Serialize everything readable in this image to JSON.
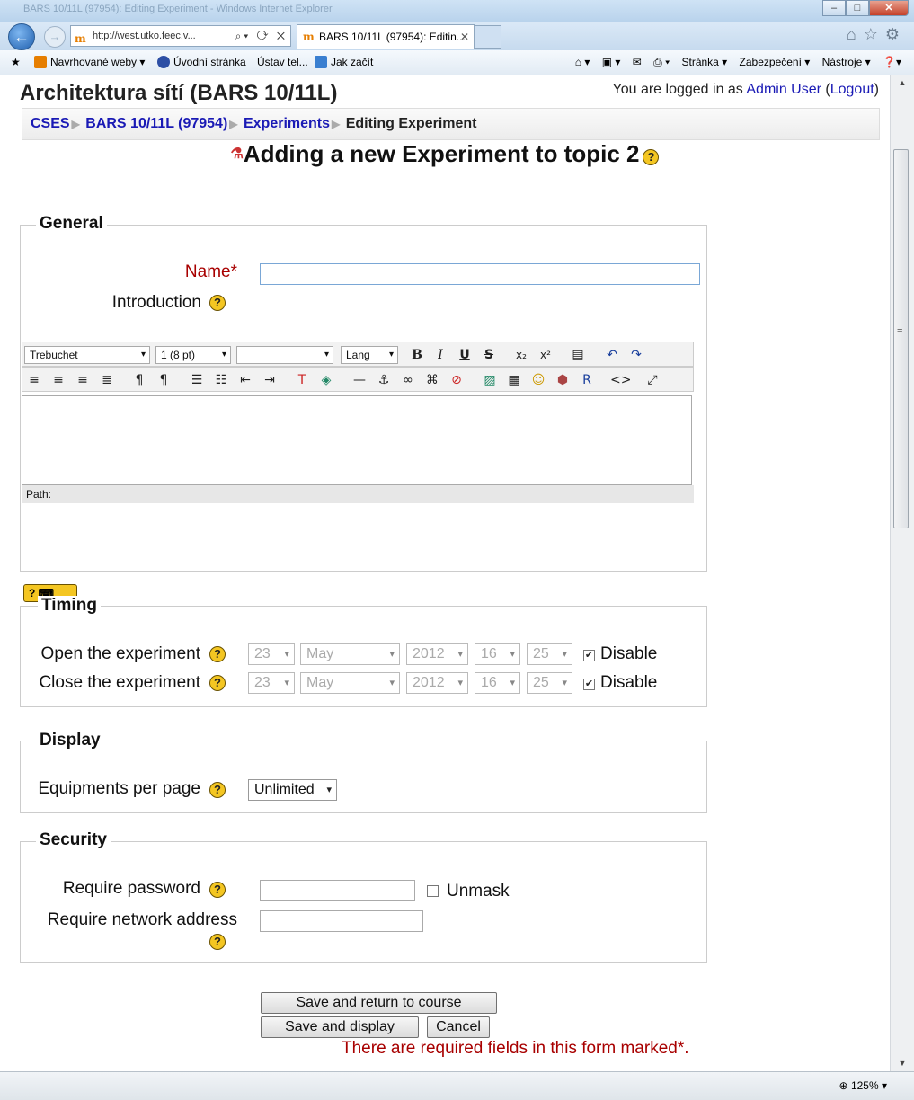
{
  "browser": {
    "window_title": "BARS 10/11L (97954): Editing Experiment - Windows Internet Explorer",
    "url": "http://west.utko.feec.v...",
    "tab_label": "BARS 10/11L (97954): Editin...",
    "favorites": [
      "Navrhované weby ▾",
      "Úvodní stránka",
      "Ústav tel...",
      "Jak začít"
    ],
    "commands": [
      "Stránka ▾",
      "Zabezpečení ▾",
      "Nástroje ▾"
    ],
    "zoom": "125%"
  },
  "site": {
    "title": "Architektura sítí (BARS 10/11L)",
    "logged_in_prefix": "You are logged in as ",
    "user": "Admin User",
    "logout": "Logout"
  },
  "breadcrumb": {
    "items": [
      "CSES",
      "BARS 10/11L (97954)",
      "Experiments"
    ],
    "current": "Editing Experiment"
  },
  "heading": "Adding a new Experiment to topic 2",
  "general": {
    "legend": "General",
    "name_label": "Name",
    "name_value": "",
    "intro_label": "Introduction",
    "editor": {
      "font": "Trebuchet",
      "size": "1 (8 pt)",
      "style": "",
      "lang": "Lang",
      "path": "Path:"
    }
  },
  "timing": {
    "legend": "Timing",
    "open_label": "Open the experiment",
    "close_label": "Close the experiment",
    "open": {
      "day": "23",
      "month": "May",
      "year": "2012",
      "hour": "16",
      "minute": "25",
      "disable": "Disable"
    },
    "close": {
      "day": "23",
      "month": "May",
      "year": "2012",
      "hour": "16",
      "minute": "25",
      "disable": "Disable"
    }
  },
  "display": {
    "legend": "Display",
    "equipments_label": "Equipments per page",
    "equipments_value": "Unlimited"
  },
  "security": {
    "legend": "Security",
    "password_label": "Require password",
    "unmask_label": "Unmask",
    "network_label": "Require network address"
  },
  "buttons": {
    "save_return": "Save and return to course",
    "save_display": "Save and display",
    "cancel": "Cancel"
  },
  "required_note": "There are required fields in this form marked",
  "required_mark": "*"
}
